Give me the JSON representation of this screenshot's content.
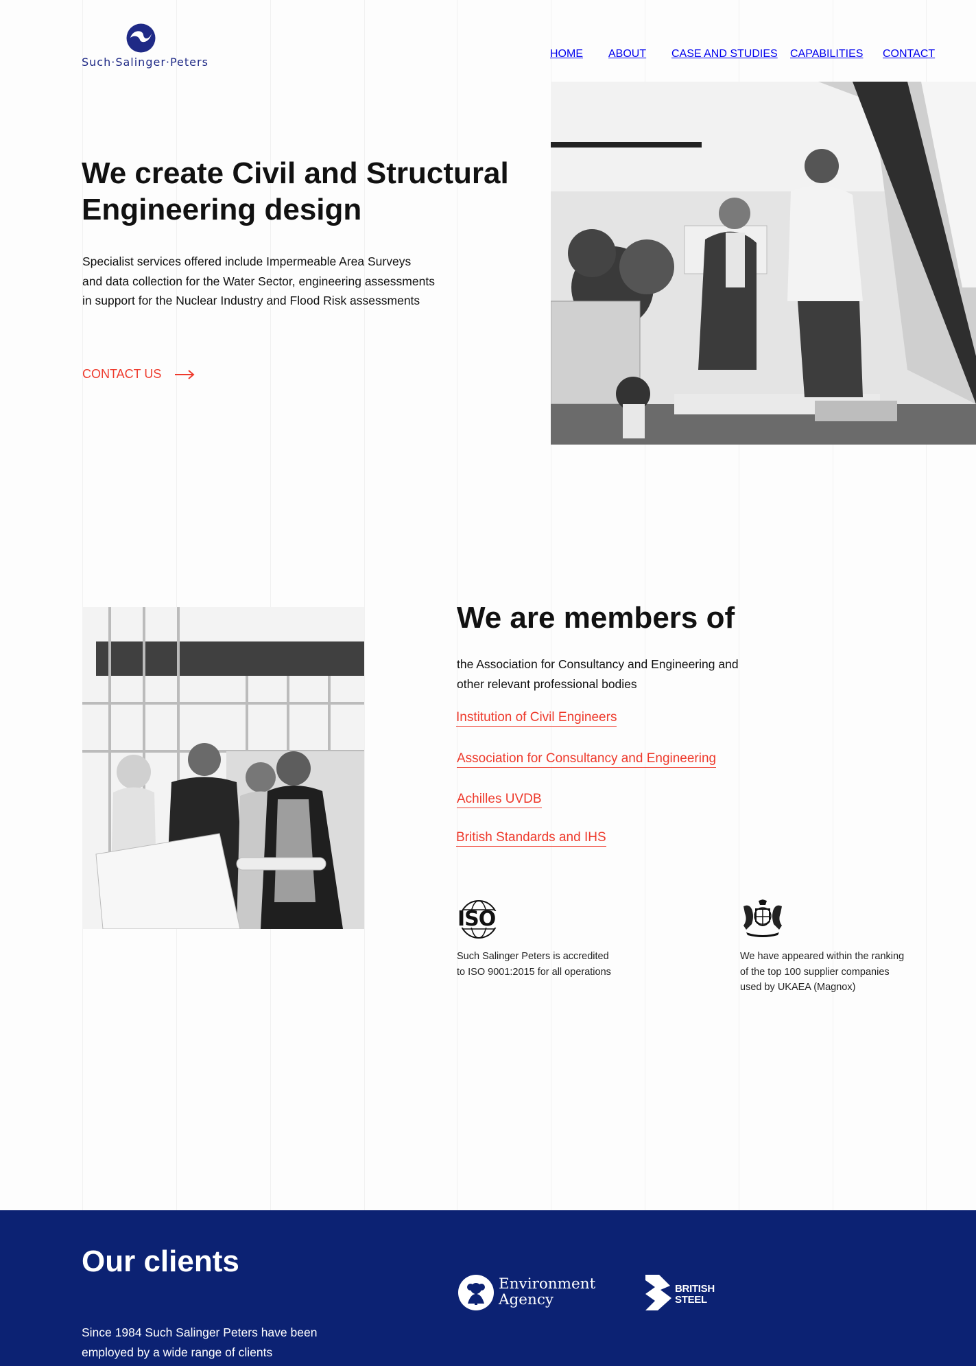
{
  "brand": {
    "name": "Such·Salinger·Peters",
    "logo_color": "#1f2a86"
  },
  "nav": [
    "HOME",
    "ABOUT",
    "CASE AND STUDIES",
    "CAPABILITIES",
    "CONTACT"
  ],
  "hero": {
    "title_line1": "We create Civil and Structural",
    "title_line2": "Engineering design",
    "text_line1": "Specialist services offered include Impermeable Area Surveys",
    "text_line2": "and data collection for the Water Sector, engineering assessments",
    "text_line3": "in support for the Nuclear Industry and Flood Risk assessments",
    "cta": "CONTACT US",
    "image": "black-and-white photo of two engineers reviewing plans at a desk"
  },
  "members": {
    "title": "We are members of",
    "text_line1": "the Association for Consultancy and Engineering and",
    "text_line2": "other relevant professional bodies",
    "links": [
      "Institution of Civil Engineers",
      "Association for Consultancy and Engineering",
      "Achilles UVDB",
      "British Standards and IHS"
    ],
    "image": "black-and-white photo of four engineers in hard hats reading blueprints",
    "iso": {
      "logo_text": "ISO",
      "line1": "Such Salinger Peters is accredited",
      "line2": "to ISO 9001:2015 for all operations"
    },
    "ukaea": {
      "line1": "We have appeared within the ranking",
      "line2": "of the top 100 supplier companies",
      "line3": "used by UKAEA (Magnox)"
    }
  },
  "clients": {
    "title": "Our clients",
    "text_line1": "Since 1984 Such Salinger Peters have been",
    "text_line2": "employed by a wide range of clients",
    "logos": {
      "environment_agency_line1": "Environment",
      "environment_agency_line2": "Agency",
      "british_steel_line1": "BRITISH",
      "british_steel_line2": "STEEL"
    }
  },
  "colors": {
    "accent": "#ee3a2c",
    "clients_bg": "#0c2273",
    "text": "#111111"
  }
}
